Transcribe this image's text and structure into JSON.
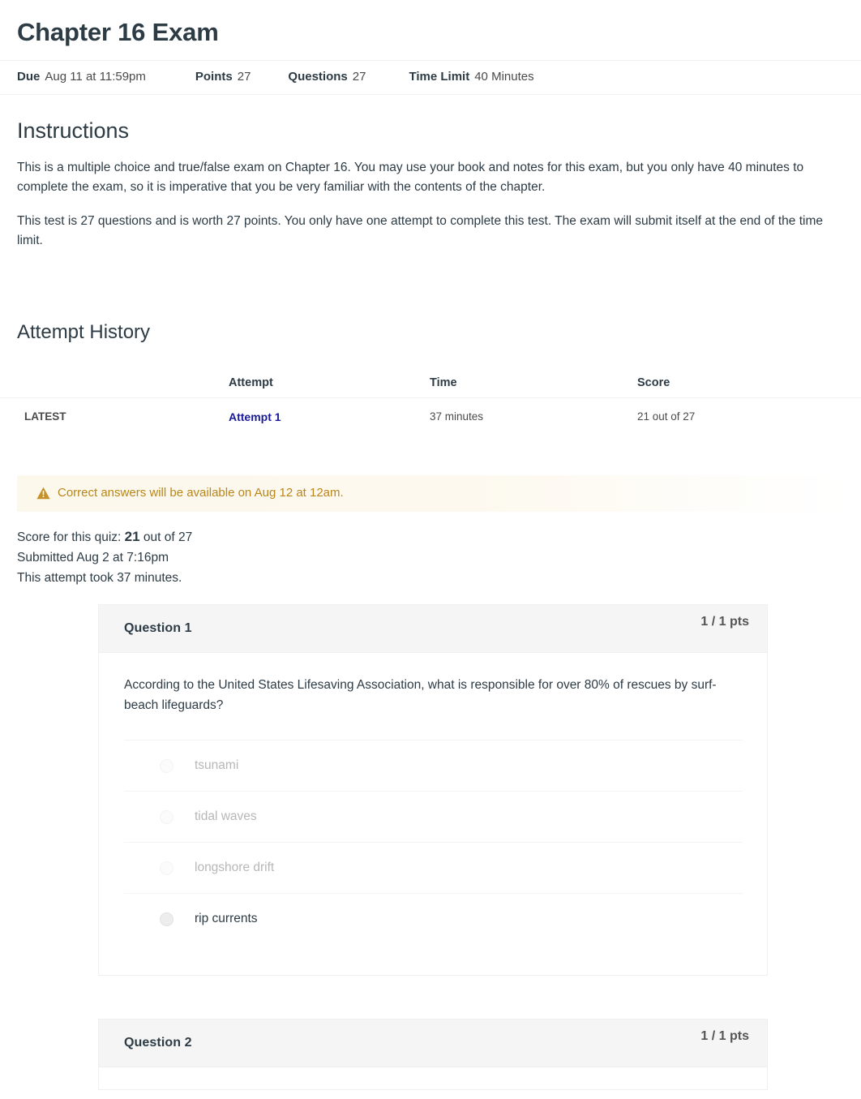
{
  "quiz": {
    "title": "Chapter 16 Exam",
    "meta": {
      "due_label": "Due",
      "due_value": "Aug 11 at 11:59pm",
      "points_label": "Points",
      "points_value": "27",
      "questions_label": "Questions",
      "questions_value": "27",
      "time_limit_label": "Time Limit",
      "time_limit_value": "40 Minutes"
    }
  },
  "instructions": {
    "heading": "Instructions",
    "paragraph_1": "This is a multiple choice and true/false exam on Chapter 16. You may use your book and notes for this exam, but you only have 40 minutes to complete the exam, so it is imperative that you be very familiar with the contents of the chapter.",
    "paragraph_2": "This test is 27 questions and is worth 27 points. You only have one attempt to complete this test. The exam will submit itself at the end of the time limit."
  },
  "attempt_history": {
    "heading": "Attempt History",
    "columns": {
      "blank": "",
      "attempt": "Attempt",
      "time": "Time",
      "score": "Score"
    },
    "rows": [
      {
        "marker": "LATEST",
        "attempt": "Attempt 1",
        "time": "37 minutes",
        "score": "21 out of 27"
      }
    ]
  },
  "warning": {
    "icon": "warning-triangle-icon",
    "text": "Correct answers will be available on Aug 12 at 12am.",
    "text_color": "#b8861b",
    "background_color": "#fdf8ec"
  },
  "score_summary": {
    "score_prefix": "Score for this quiz:",
    "score_value": "21",
    "score_suffix": "out of 27",
    "submitted": "Submitted Aug 2 at 7:16pm",
    "duration": "This attempt took 37 minutes."
  },
  "questions": [
    {
      "name": "Question 1",
      "points": "1 / 1 pts",
      "text": "According to the United States Lifesaving Association, what is responsible for over 80% of rescues by surf-beach lifeguards?",
      "answers": [
        {
          "label": "tsunami",
          "selected": false
        },
        {
          "label": "tidal waves",
          "selected": false
        },
        {
          "label": "longshore drift",
          "selected": false
        },
        {
          "label": "rip currents",
          "selected": true
        }
      ]
    },
    {
      "name": "Question 2",
      "points": "1 / 1 pts",
      "text": "",
      "answers": []
    }
  ],
  "colors": {
    "link": "#1a1a99",
    "text": "#2d3b45",
    "muted": "#b7b7b7",
    "card_header": "#f5f5f5"
  }
}
